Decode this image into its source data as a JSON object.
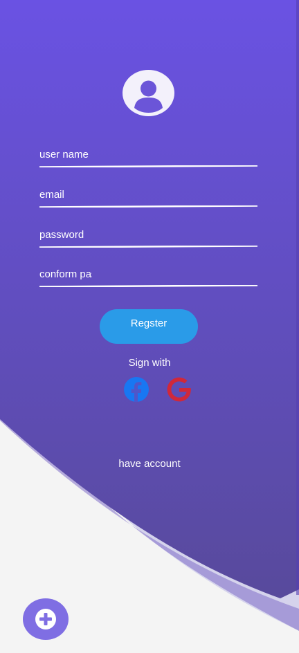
{
  "form": {
    "username_placeholder": "user name",
    "email_placeholder": "email",
    "password_placeholder": "password",
    "confirm_placeholder": "conform password",
    "register_label": "Regster"
  },
  "social": {
    "sign_with_label": "Sign with",
    "providers": [
      "facebook-icon",
      "google-icon"
    ]
  },
  "footer": {
    "have_account_label": "have account"
  },
  "icons": {
    "avatar": "user-avatar-icon",
    "fab": "plus-circle-icon"
  },
  "colors": {
    "gradient_top": "#6a52e3",
    "gradient_bottom": "#584a9c",
    "button": "#2a9be8",
    "facebook": "#1877f2",
    "google": "#d0283a",
    "fab": "#7f6ee3"
  }
}
